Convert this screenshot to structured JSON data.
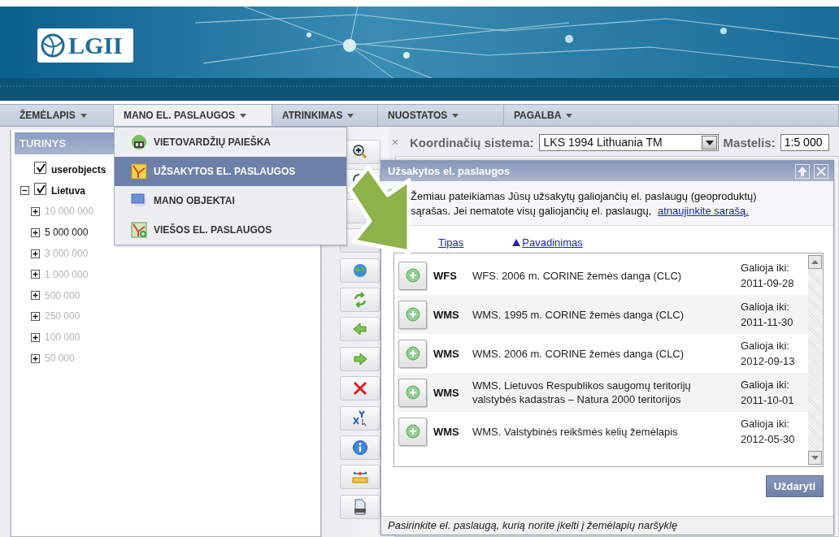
{
  "header": {
    "logo": "LGII"
  },
  "menu": [
    {
      "label": "ŽEMĖLAPIS",
      "selected": false
    },
    {
      "label": "MANO EL. PASLAUGOS",
      "selected": true
    },
    {
      "label": "ATRINKIMAS",
      "selected": false
    },
    {
      "label": "NUOSTATOS",
      "selected": false
    },
    {
      "label": "PAGALBA",
      "selected": false
    }
  ],
  "dropdown": {
    "items": [
      {
        "label": "VIETOVARDŽIŲ PAIEŠKA",
        "selected": false
      },
      {
        "label": "UŽSAKYTOS EL. PASLAUGOS",
        "selected": true
      },
      {
        "label": "MANO OBJEKTAI",
        "selected": false
      },
      {
        "label": "VIEŠOS EL. PASLAUGOS",
        "selected": false
      }
    ]
  },
  "sidebar": {
    "title": "TURINYS",
    "tree": [
      {
        "label": "userobjects",
        "checked": true
      },
      {
        "label": "Lietuva",
        "checked": true,
        "expanded": true,
        "children": [
          {
            "label": "10 000 000",
            "expanded": false,
            "disabled": true
          },
          {
            "label": "5 000 000",
            "expanded": false,
            "disabled": false
          },
          {
            "label": "3 000 000",
            "expanded": false,
            "disabled": true
          },
          {
            "label": "1 000 000",
            "expanded": false,
            "disabled": true
          },
          {
            "label": "500 000",
            "expanded": false,
            "disabled": true
          },
          {
            "label": "250 000",
            "expanded": false,
            "disabled": true
          },
          {
            "label": "100 000",
            "expanded": false,
            "disabled": true
          },
          {
            "label": "50 000",
            "expanded": false,
            "disabled": true
          }
        ]
      }
    ]
  },
  "map_toolbar": {
    "close": "×",
    "crs_label": "Koordinačių sistema:",
    "crs_value": "LKS 1994 Lithuania TM",
    "scale_label": "Mastelis:",
    "scale_value": "1:5 000"
  },
  "dialog": {
    "title": "Užsakytos el. paslaugos",
    "intro": "Žemiau pateikiamas Jūsų užsakytų galiojančių el. paslaugų (geoproduktų) sąrašas. Jei nematote visų galiojančių el. paslaugų,",
    "link": "atnaujinkite sarašą.",
    "sort": [
      {
        "label": "Tipas",
        "selected": false
      },
      {
        "label": "Pavadinimas",
        "selected": true
      }
    ],
    "rows": [
      {
        "type": "WFS",
        "name": "WFS. 2006 m. CORINE žemės danga (CLC)",
        "valid_label": "Galioja iki:",
        "valid_until": "2011-09-28"
      },
      {
        "type": "WMS",
        "name": "WMS. 1995 m. CORINE žemės danga (CLC)",
        "valid_label": "Galioja iki:",
        "valid_until": "2011-11-30"
      },
      {
        "type": "WMS",
        "name": "WMS. 2006 m. CORINE žemės danga (CLC)",
        "valid_label": "Galioja iki:",
        "valid_until": "2012-09-13"
      },
      {
        "type": "WMS",
        "name": "WMS. Lietuvos Respublikos saugomų teritorijų valstybės kadastras – Natura 2000 teritorijos",
        "valid_label": "Galioja iki:",
        "valid_until": "2011-10-01"
      },
      {
        "type": "WMS",
        "name": "WMS. Valstybinės reikšmės kelių žemėlapis",
        "valid_label": "Galioja iki:",
        "valid_until": "2012-05-30"
      }
    ],
    "button": "Uždaryti",
    "status": "Pasirinkite el. paslaugą, kurią norite įkelti į žemėlapių naršyklę"
  }
}
